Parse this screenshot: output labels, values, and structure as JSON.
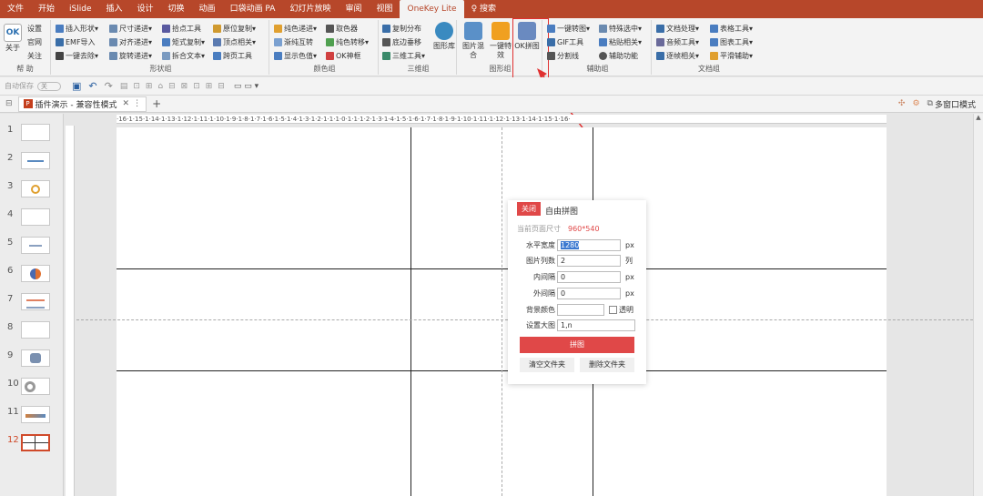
{
  "tabs": [
    "文件",
    "开始",
    "iSlide",
    "插入",
    "设计",
    "切换",
    "动画",
    "口袋动画 PA",
    "幻灯片放映",
    "审阅",
    "视图",
    "OneKey Lite"
  ],
  "search_label": "搜索",
  "ribbon": {
    "g1": {
      "about": "关于",
      "items": [
        "设置",
        "官网",
        "关注"
      ],
      "label": "帮 助"
    },
    "g2": {
      "items": [
        "插入形状",
        "尺寸递进",
        "拾点工具",
        "原位复制",
        "EMF导入",
        "对齐递进",
        "矩式复制",
        "顶点相关",
        "一键去除",
        "旋转递进",
        "拆合文本",
        "跨页工具"
      ],
      "label": "形状组"
    },
    "g3": {
      "items": [
        "纯色递进",
        "取色器",
        "渐纯互转",
        "纯色转移",
        "显示色值",
        "OK神框"
      ],
      "label": "颜色组"
    },
    "g4": {
      "items": [
        "复制分布",
        "底边垂移",
        "三维工具"
      ],
      "shape_lib": "图形库",
      "label": "三维组"
    },
    "g5": {
      "items": [
        "图片混合",
        "一键特效",
        "OK拼图"
      ],
      "label": "图形组"
    },
    "g6": {
      "items": [
        "一键转图",
        "特殊选中",
        "GIF工具",
        "粘贴相关",
        "分割线",
        "辅助功能"
      ],
      "label": "辅助组"
    },
    "g7": {
      "items": [
        "文档处理",
        "表格工具",
        "音频工具",
        "图表工具",
        "逐帧相关",
        "平滑辅助"
      ],
      "label": "文档组"
    }
  },
  "qat": {
    "autosave": "自动保存",
    "toggle": "关"
  },
  "doc_tab": {
    "name": "插件演示 - 兼容性模式",
    "multi": "多窗口模式"
  },
  "thumbs": [
    "1",
    "2",
    "3",
    "4",
    "5",
    "6",
    "7",
    "8",
    "9",
    "10",
    "11",
    "12"
  ],
  "ruler_h": "·16·1·15·1·14·1·13·1·12·1·11·1·10·1·9·1·8·1·7·1·6·1·5·1·4·1·3·1·2·1·1·1·0·1·1·1·2·1·3·1·4·1·5·1·6·1·7·1·8·1·9·1·10·1·11·1·12·1·13·1·14·1·15·1·16·",
  "dialog": {
    "close": "关闭",
    "title": "自由拼图",
    "size_label": "当前页面尺寸",
    "size_value": "960*540",
    "width_label": "水平宽度",
    "width_value": "1280",
    "width_unit": "px",
    "cols_label": "图片列数",
    "cols_value": "2",
    "cols_unit": "列",
    "inner_label": "内间隔",
    "inner_value": "0",
    "inner_unit": "px",
    "outer_label": "外间隔",
    "outer_value": "0",
    "outer_unit": "px",
    "bg_label": "背景颜色",
    "transparent": "透明",
    "big_label": "设置大图",
    "big_value": "1,n",
    "run": "拼图",
    "clear": "清空文件夹",
    "delete": "删除文件夹"
  },
  "colors": {
    "accent": "#b7472a",
    "dialog_red": "#e04848",
    "highlight": "#e03030"
  }
}
